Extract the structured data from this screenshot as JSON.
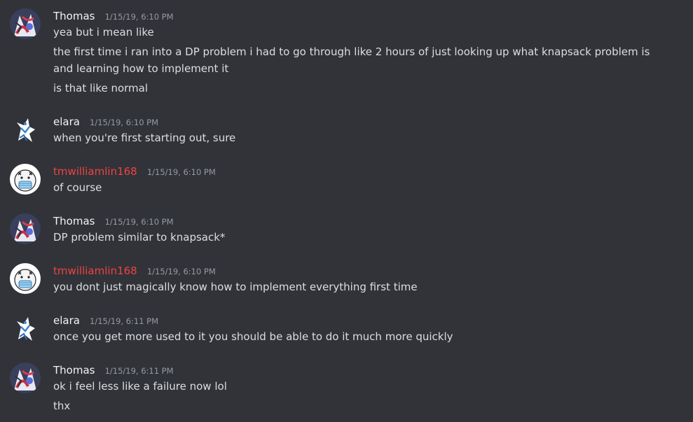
{
  "colors": {
    "background": "#313338",
    "text": "#dbdee1",
    "username_default": "#f2f3f5",
    "username_red": "#ed4245",
    "timestamp": "#949ba4"
  },
  "messages": [
    {
      "author": "Thomas",
      "avatar": "thomas-avatar",
      "timestamp": "1/15/19, 6:10 PM",
      "lines": [
        "yea but i mean like",
        "the first time i ran into a DP problem i had to go through like 2 hours of just looking up what knapsack problem is and learning how to implement it",
        "is that like normal"
      ]
    },
    {
      "author": "elara",
      "avatar": "elara-avatar",
      "timestamp": "1/15/19, 6:10 PM",
      "lines": [
        "when you're first starting out, sure"
      ]
    },
    {
      "author": "tmwilliamlin168",
      "avatar": "tmwilliamlin-avatar",
      "timestamp": "1/15/19, 6:10 PM",
      "lines": [
        "of course"
      ]
    },
    {
      "author": "Thomas",
      "avatar": "thomas-avatar",
      "timestamp": "1/15/19, 6:10 PM",
      "lines": [
        "DP problem similar to knapsack*"
      ]
    },
    {
      "author": "tmwilliamlin168",
      "avatar": "tmwilliamlin-avatar",
      "timestamp": "1/15/19, 6:10 PM",
      "lines": [
        "you dont just magically know how to implement everything first time"
      ]
    },
    {
      "author": "elara",
      "avatar": "elara-avatar",
      "timestamp": "1/15/19, 6:11 PM",
      "lines": [
        "once you get more used to it you should be able to do it much more quickly"
      ]
    },
    {
      "author": "Thomas",
      "avatar": "thomas-avatar",
      "timestamp": "1/15/19, 6:11 PM",
      "lines": [
        "ok i feel less like a failure now lol",
        "thx"
      ]
    }
  ]
}
